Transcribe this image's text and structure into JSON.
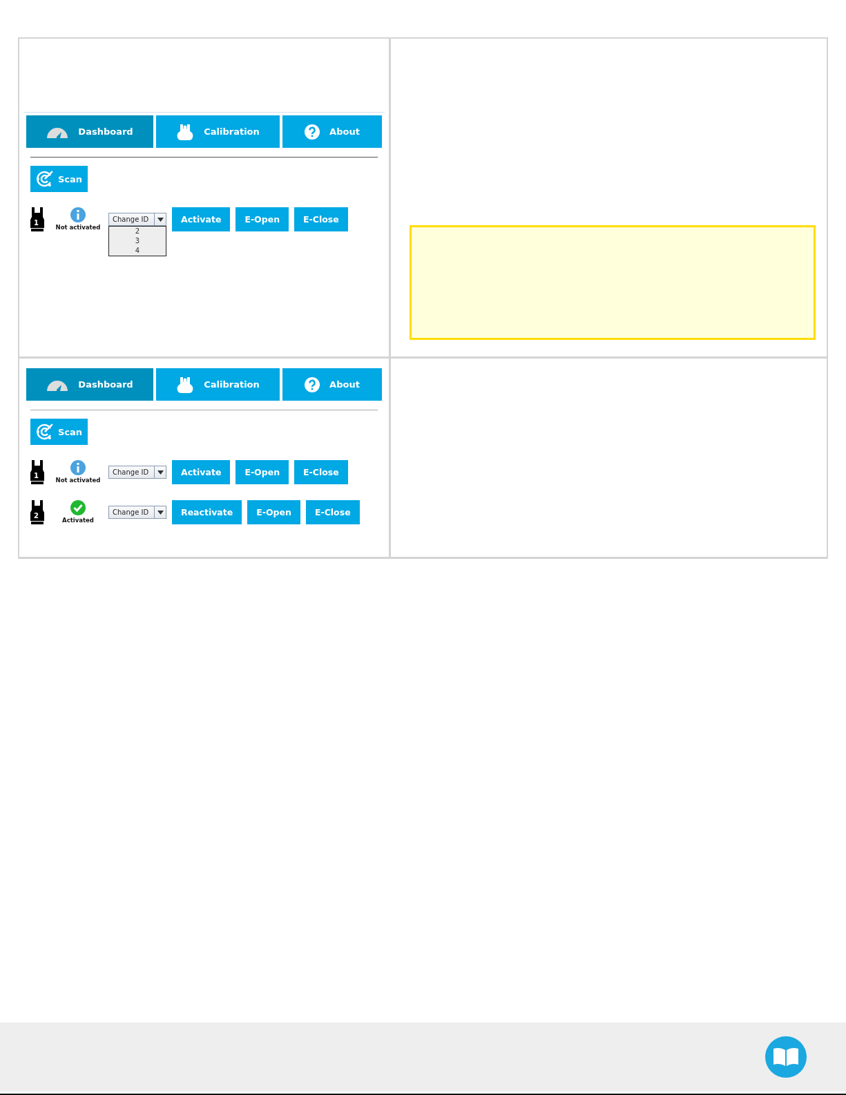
{
  "panels": [
    {
      "top_spacer": true,
      "tabs": [
        {
          "label": "Dashboard",
          "selected": true
        },
        {
          "label": "Calibration",
          "selected": false
        },
        {
          "label": "About",
          "selected": false
        }
      ],
      "scan_button": "Scan",
      "grippers": [
        {
          "number": "1",
          "kind": "info",
          "status_label": "Not activated",
          "dropdown": {
            "value": "Change ID",
            "expanded": true,
            "options": [
              "2",
              "3",
              "4"
            ]
          },
          "buttons": [
            "Activate",
            "E-Open",
            "E-Close"
          ]
        }
      ],
      "note": {
        "kind": "warning"
      }
    },
    {
      "top_spacer": false,
      "tabs": [
        {
          "label": "Dashboard",
          "selected": true
        },
        {
          "label": "Calibration",
          "selected": false
        },
        {
          "label": "About",
          "selected": false
        }
      ],
      "scan_button": "Scan",
      "grippers": [
        {
          "number": "1",
          "kind": "info",
          "status_label": "Not activated",
          "dropdown": {
            "value": "Change ID",
            "expanded": false
          },
          "buttons": [
            "Activate",
            "E-Open",
            "E-Close"
          ]
        },
        {
          "number": "2",
          "kind": "ok",
          "status_label": "Activated",
          "dropdown": {
            "value": "Change ID",
            "expanded": false
          },
          "buttons": [
            "Reactivate",
            "E-Open",
            "E-Close"
          ]
        }
      ]
    }
  ]
}
